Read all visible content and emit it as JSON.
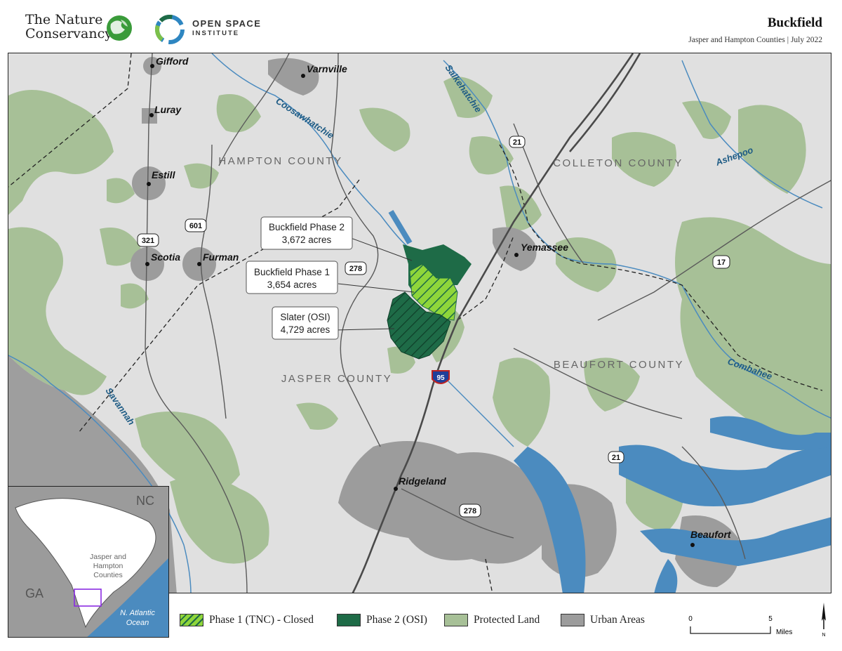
{
  "header": {
    "tnc_logo_line1": "The Nature",
    "tnc_logo_line2": "Conservancy",
    "osi_logo_line1": "OPEN SPACE",
    "osi_logo_line2": "INSTITUTE",
    "title": "Buckfield",
    "subtitle": "Jasper and Hampton Counties | July 2022"
  },
  "colors": {
    "background_land": "#e0e0e0",
    "protected_land": "#a7c097",
    "phase1_tnc": "#8fd63a",
    "phase2_osi": "#1e6b47",
    "slater_osi": "#1e6b47",
    "urban": "#9c9c9c",
    "water": "#4b8bbf",
    "roads": "#5a5a5a"
  },
  "map": {
    "counties": [
      {
        "label": "HAMPTON COUNTY"
      },
      {
        "label": "COLLETON COUNTY"
      },
      {
        "label": "JASPER COUNTY"
      },
      {
        "label": "BEAUFORT COUNTY"
      }
    ],
    "rivers": [
      {
        "label": "Coosawhatchie"
      },
      {
        "label": "Salkehatchie"
      },
      {
        "label": "Ashepoo"
      },
      {
        "label": "Combahee"
      },
      {
        "label": "Savannah"
      }
    ],
    "towns": [
      {
        "label": "Gifford"
      },
      {
        "label": "Varnville"
      },
      {
        "label": "Luray"
      },
      {
        "label": "Estill"
      },
      {
        "label": "Scotia"
      },
      {
        "label": "Furman"
      },
      {
        "label": "Yemassee"
      },
      {
        "label": "Ridgeland"
      },
      {
        "label": "Beaufort"
      }
    ],
    "highways": [
      {
        "label": "21"
      },
      {
        "label": "601"
      },
      {
        "label": "321"
      },
      {
        "label": "278"
      },
      {
        "label": "17"
      },
      {
        "label": "21"
      },
      {
        "label": "278"
      },
      {
        "label": "95"
      }
    ],
    "callouts": [
      {
        "line1": "Buckfield Phase 2",
        "line2": "3,672 acres"
      },
      {
        "line1": "Buckfield Phase 1",
        "line2": "3,654 acres"
      },
      {
        "line1": "Slater (OSI)",
        "line2": "4,729 acres"
      }
    ]
  },
  "inset": {
    "state_label": "NC",
    "neighbor_label": "GA",
    "focus_line1": "Jasper and",
    "focus_line2": "Hampton",
    "focus_line3": "Counties",
    "ocean_line1": "N. Atlantic",
    "ocean_line2": "Ocean"
  },
  "legend": {
    "items": [
      {
        "label": "Phase 1 (TNC) - Closed",
        "icon": "hatched-light-green-swatch"
      },
      {
        "label": "Phase 2 (OSI)",
        "icon": "dark-green-swatch"
      },
      {
        "label": "Protected Land",
        "icon": "pale-green-swatch"
      },
      {
        "label": "Urban Areas",
        "icon": "gray-swatch"
      }
    ],
    "scale_min": "0",
    "scale_max": "5",
    "scale_unit": "Miles",
    "north": "N"
  }
}
